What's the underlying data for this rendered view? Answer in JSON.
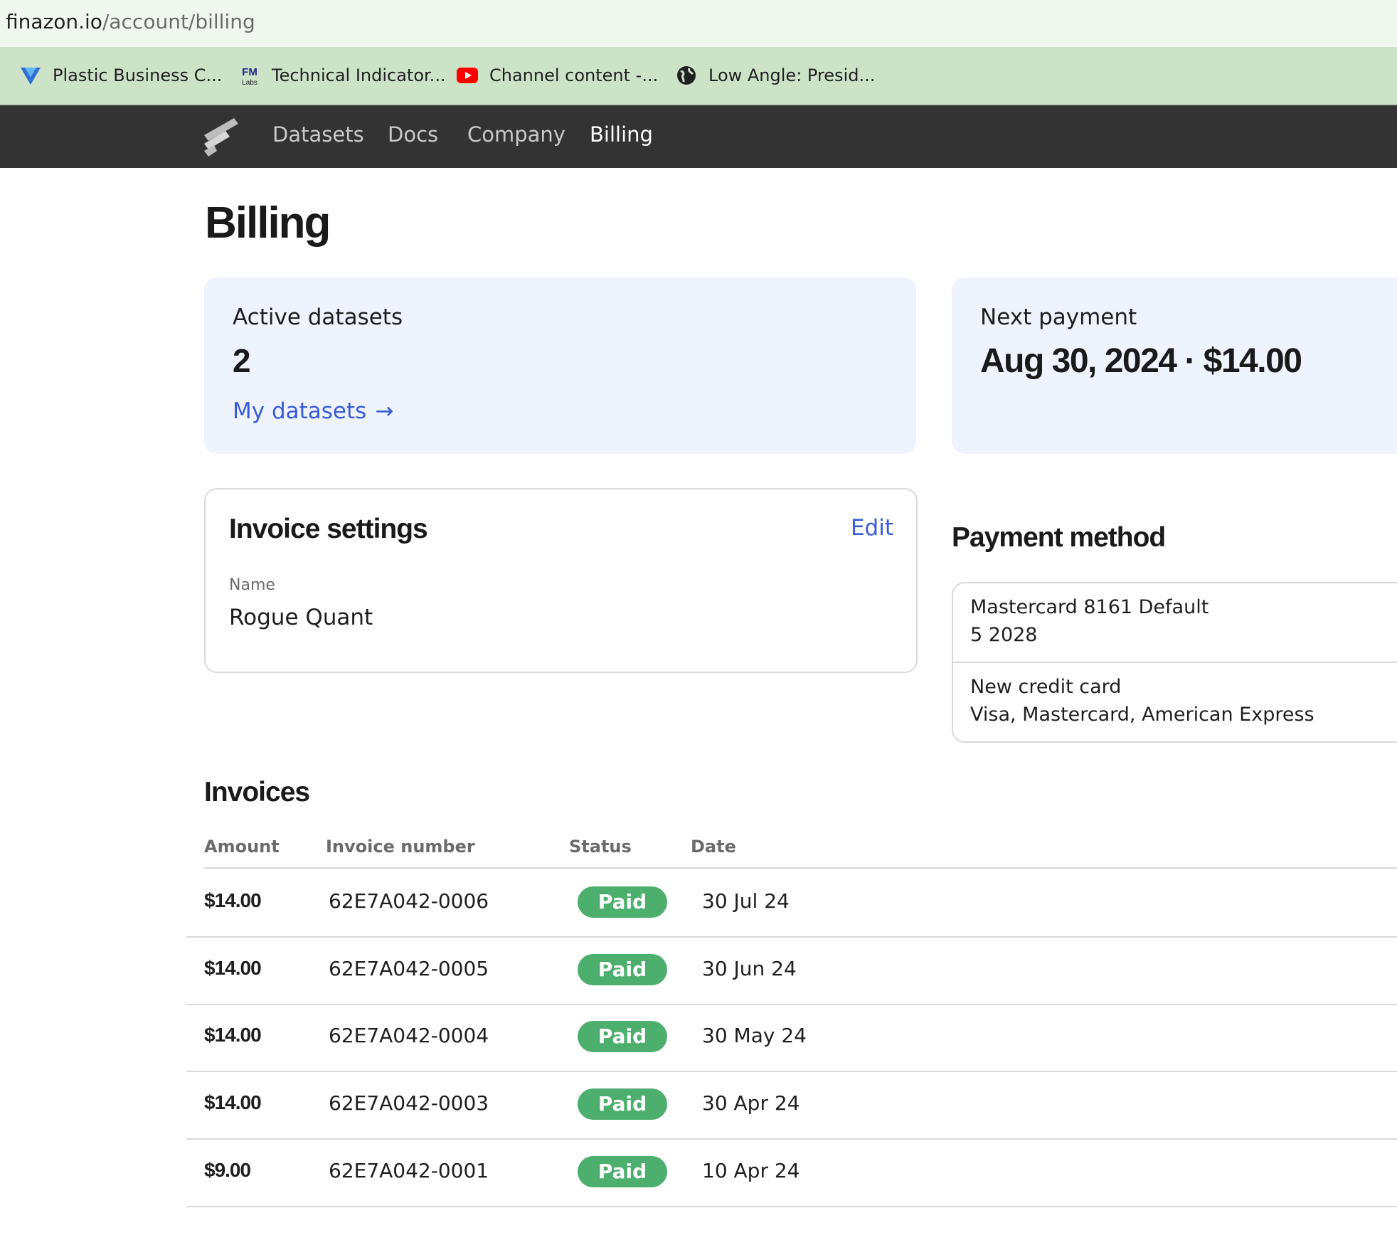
{
  "browser": {
    "url_host": "finazon.io",
    "url_path": "/account/billing",
    "bookmarks": [
      {
        "label": "Plastic Business C...",
        "icon": "triangle-logo-icon"
      },
      {
        "label": "Technical Indicator...",
        "icon": "fm-labs-icon"
      },
      {
        "label": "Channel content -...",
        "icon": "youtube-icon"
      },
      {
        "label": "Low Angle: Presid...",
        "icon": "globe-icon"
      }
    ]
  },
  "nav": {
    "logo_icon": "finazon-logo-icon",
    "items": [
      {
        "label": "Datasets"
      },
      {
        "label": "Docs"
      },
      {
        "label": "Company"
      },
      {
        "label": "Billing",
        "active": true
      }
    ]
  },
  "page": {
    "title": "Billing"
  },
  "active_datasets": {
    "label": "Active datasets",
    "value": "2",
    "link_label": "My datasets",
    "link_arrow": "→"
  },
  "next_payment": {
    "label": "Next payment",
    "value": "Aug 30, 2024 · $14.00"
  },
  "invoice_settings": {
    "title": "Invoice settings",
    "edit_label": "Edit",
    "name_label": "Name",
    "name_value": "Rogue Quant"
  },
  "payment_method": {
    "title": "Payment method",
    "items": [
      {
        "line1": "Mastercard 8161 Default",
        "line2": "5 2028"
      },
      {
        "line1": "New credit card",
        "line2": "Visa, Mastercard, American Express"
      }
    ]
  },
  "invoices": {
    "title": "Invoices",
    "columns": [
      "Amount",
      "Invoice number",
      "Status",
      "Date"
    ],
    "rows": [
      {
        "amount": "$14.00",
        "number": "62E7A042-0006",
        "status": "Paid",
        "date": "30 Jul 24"
      },
      {
        "amount": "$14.00",
        "number": "62E7A042-0005",
        "status": "Paid",
        "date": "30 Jun 24"
      },
      {
        "amount": "$14.00",
        "number": "62E7A042-0004",
        "status": "Paid",
        "date": "30 May 24"
      },
      {
        "amount": "$14.00",
        "number": "62E7A042-0003",
        "status": "Paid",
        "date": "30 Apr 24"
      },
      {
        "amount": "$9.00",
        "number": "62E7A042-0001",
        "status": "Paid",
        "date": "10 Apr 24"
      }
    ]
  },
  "colors": {
    "nav_bg": "#333333",
    "card_bg": "#eff3fd",
    "link": "#3a5bd9",
    "paid_badge": "#4caf6d",
    "bookmarks_bg": "#cce3c8"
  }
}
